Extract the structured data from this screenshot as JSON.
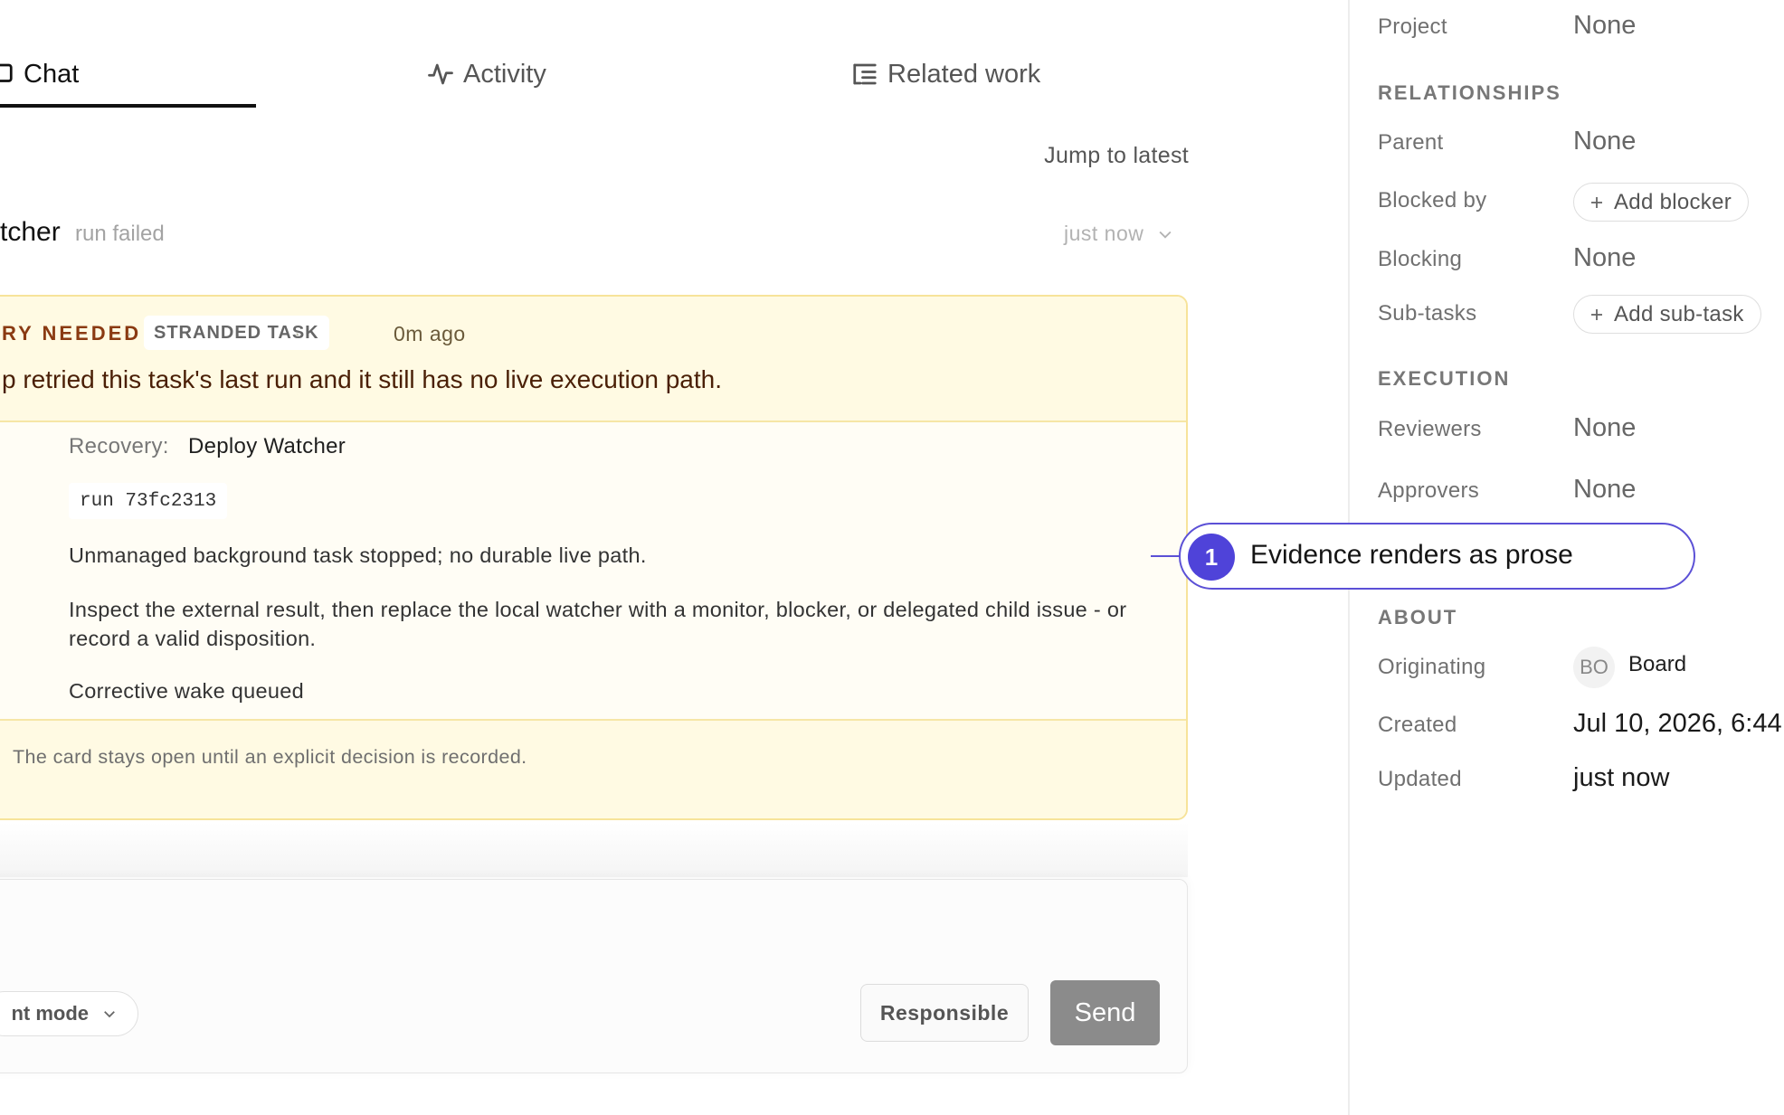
{
  "tabs": [
    {
      "label": "Chat",
      "icon": "chat-icon",
      "active": true
    },
    {
      "label": "Activity",
      "icon": "activity-icon",
      "active": false
    },
    {
      "label": "Related work",
      "icon": "list-tree-icon",
      "active": false
    }
  ],
  "thread": {
    "jump_label": "Jump to latest",
    "author": "tcher",
    "status": "run failed",
    "time": "just now"
  },
  "card": {
    "kicker": "RY NEEDED",
    "pill": "STRANDED TASK",
    "ago": "0m ago",
    "title": "p retried this task's last run and it still has no live execution path.",
    "recovery_label": "Recovery:",
    "recovery_value": "Deploy Watcher",
    "run_code": "run 73fc2313",
    "para1": "Unmanaged background task stopped; no durable live path.",
    "para2": "Inspect the external result, then replace the local watcher with a monitor, blocker, or delegated child issue - or record a valid disposition.",
    "para3": "Corrective wake queued",
    "footer": "The card stays open until an explicit decision is recorded."
  },
  "composer": {
    "mode_label": "nt mode",
    "responsible_label": "Responsible",
    "send_label": "Send"
  },
  "panel": {
    "project_label": "Project",
    "project_value": "None",
    "relationships_heading": "RELATIONSHIPS",
    "parent_label": "Parent",
    "parent_value": "None",
    "blocked_by_label": "Blocked by",
    "add_blocker": "Add blocker",
    "blocking_label": "Blocking",
    "blocking_value": "None",
    "subtasks_label": "Sub-tasks",
    "add_subtask": "Add sub-task",
    "execution_heading": "EXECUTION",
    "reviewers_label": "Reviewers",
    "reviewers_value": "None",
    "approvers_label": "Approvers",
    "approvers_value": "None",
    "about_heading": "ABOUT",
    "originating_label": "Originating",
    "originating_initials": "BO",
    "originating_name": "Board",
    "created_label": "Created",
    "created_value": "Jul 10, 2026, 6:44",
    "updated_label": "Updated",
    "updated_value": "just now"
  },
  "callout": {
    "number": "1",
    "text": "Evidence renders as prose",
    "color": "#4f43d9"
  }
}
